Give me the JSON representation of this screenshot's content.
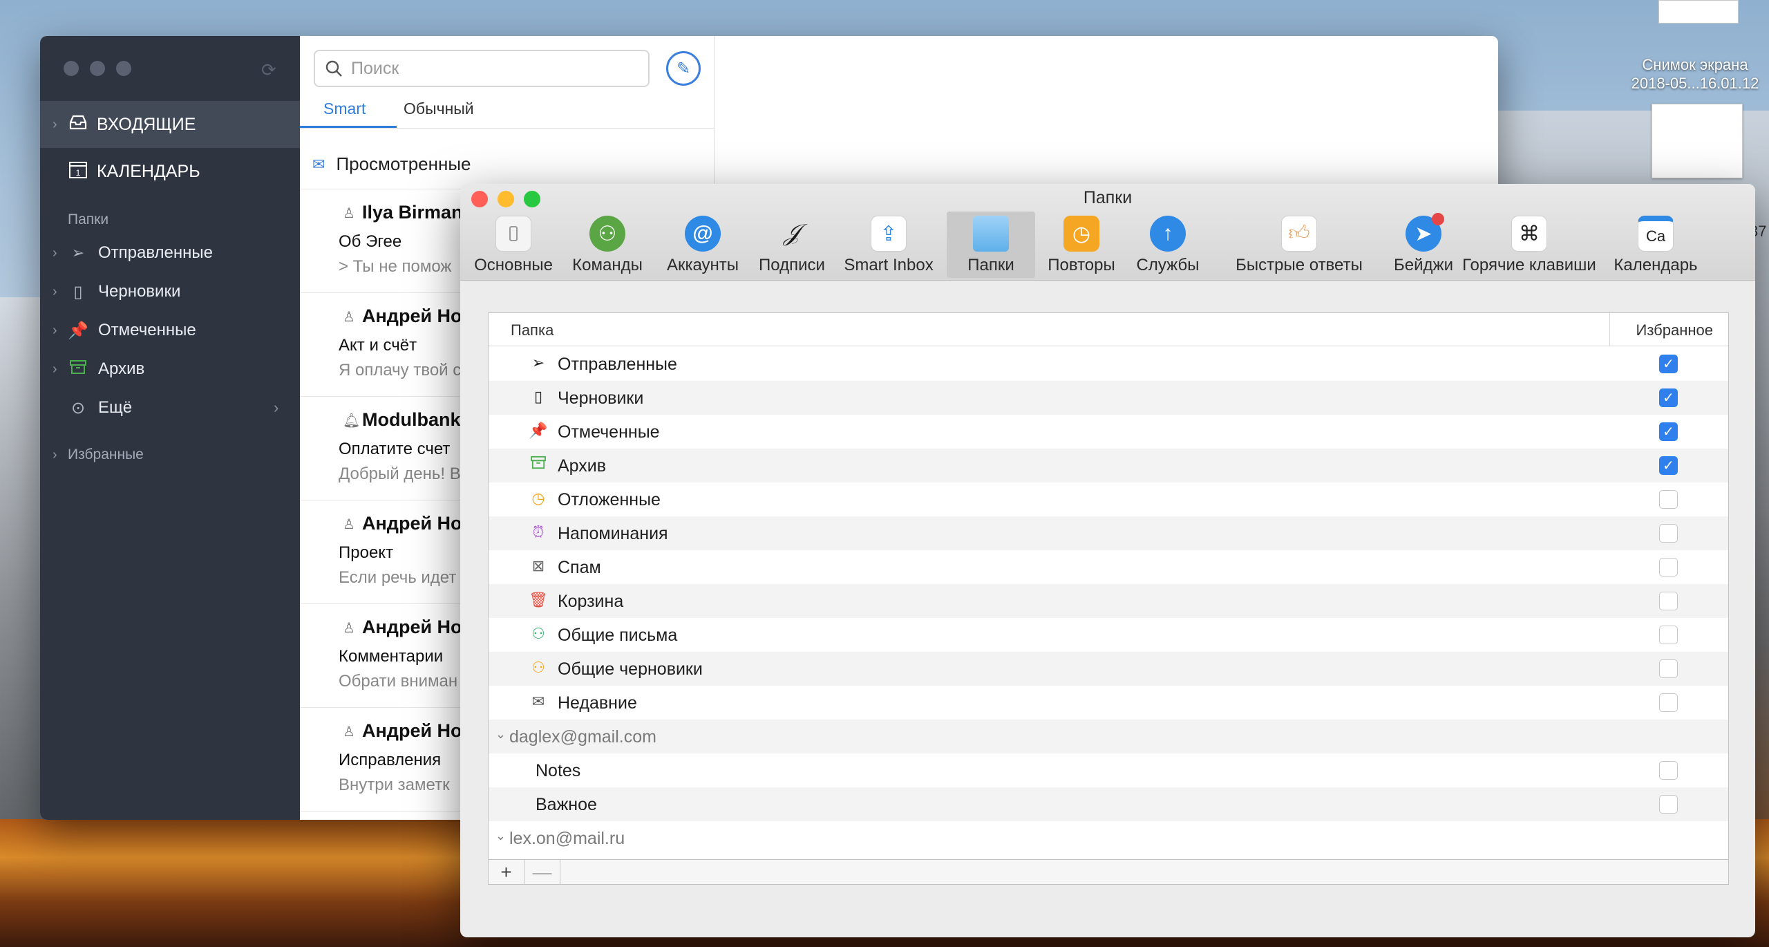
{
  "desktop": {
    "file_label_line1": "Снимок экрана",
    "file_label_line2": "2018-05...16.01.12",
    "edge_text": "37"
  },
  "mail": {
    "sidebar": {
      "inbox": "ВХОДЯЩИЕ",
      "calendar": "КАЛЕНДАРЬ",
      "calendar_day": "1",
      "folders_header": "Папки",
      "folders": [
        {
          "label": "Отправленные",
          "icon": "paper-plane-icon"
        },
        {
          "label": "Черновики",
          "icon": "document-icon"
        },
        {
          "label": "Отмеченные",
          "icon": "pin-icon",
          "color": "#f26b3a"
        },
        {
          "label": "Архив",
          "icon": "archive-icon",
          "color": "#4caf50"
        },
        {
          "label": "Ещё",
          "icon": "more-icon"
        }
      ],
      "favorites": "Избранные"
    },
    "list": {
      "search_placeholder": "Поиск",
      "tabs": [
        "Smart",
        "Обычный"
      ],
      "seen": "Просмотренные",
      "messages": [
        {
          "from": "Ilya Birman",
          "subject": "Об Эгее",
          "preview": "> Ты не помож"
        },
        {
          "from": "Андрей Но",
          "subject": "Акт и счёт",
          "preview": "Я оплачу твой с"
        },
        {
          "from": "Modulbank",
          "subject": "Оплатите счет",
          "preview": "Добрый день! В"
        },
        {
          "from": "Андрей Но",
          "subject": "Проект",
          "preview": "Если речь идет"
        },
        {
          "from": "Андрей Но",
          "subject": "Комментарии",
          "preview": "Обрати вниман"
        },
        {
          "from": "Андрей Но",
          "subject": "Исправления",
          "preview": "Внутри заметк"
        }
      ]
    }
  },
  "prefs": {
    "title": "Папки",
    "toolbar": [
      {
        "label": "Основные",
        "icon": "switch-icon"
      },
      {
        "label": "Команды",
        "icon": "team-icon"
      },
      {
        "label": "Аккаунты",
        "icon": "at-icon"
      },
      {
        "label": "Подписи",
        "icon": "signature-icon"
      },
      {
        "label": "Smart Inbox",
        "icon": "smart-inbox-icon"
      },
      {
        "label": "Папки",
        "icon": "folder-icon"
      },
      {
        "label": "Повторы",
        "icon": "clock-icon"
      },
      {
        "label": "Службы",
        "icon": "upload-icon"
      },
      {
        "label": "Быстрые ответы",
        "icon": "thumbs-up-icon"
      },
      {
        "label": "Бейджи",
        "icon": "badge-icon"
      },
      {
        "label": "Горячие клавиши",
        "icon": "command-key-icon"
      },
      {
        "label": "Календарь",
        "icon": "calendar-icon",
        "abbr": "Ca"
      }
    ],
    "selected_tab": "Папки",
    "table": {
      "col_folder": "Папка",
      "col_favorite": "Избранное",
      "rows": [
        {
          "type": "folder",
          "label": "Отправленные",
          "icon": "paper-plane-icon",
          "checked": true
        },
        {
          "type": "folder",
          "label": "Черновики",
          "icon": "document-icon",
          "checked": true
        },
        {
          "type": "folder",
          "label": "Отмеченные",
          "icon": "pin-icon",
          "checked": true
        },
        {
          "type": "folder",
          "label": "Архив",
          "icon": "archive-icon",
          "checked": true
        },
        {
          "type": "folder",
          "label": "Отложенные",
          "icon": "clock-icon",
          "checked": false
        },
        {
          "type": "folder",
          "label": "Напоминания",
          "icon": "alarm-icon",
          "checked": false
        },
        {
          "type": "folder",
          "label": "Спам",
          "icon": "spam-icon",
          "checked": false
        },
        {
          "type": "folder",
          "label": "Корзина",
          "icon": "trash-icon",
          "checked": false
        },
        {
          "type": "folder",
          "label": "Общие письма",
          "icon": "shared-icon",
          "checked": false
        },
        {
          "type": "folder",
          "label": "Общие черновики",
          "icon": "shared-drafts-icon",
          "checked": false
        },
        {
          "type": "folder",
          "label": "Недавние",
          "icon": "recent-icon",
          "checked": false
        },
        {
          "type": "account",
          "label": "daglex@gmail.com"
        },
        {
          "type": "plain",
          "label": "Notes",
          "checked": false
        },
        {
          "type": "plain",
          "label": "Важное",
          "checked": false
        },
        {
          "type": "account",
          "label": "lex.on@mail.ru"
        }
      ]
    },
    "add_label": "+",
    "remove_label": "—"
  }
}
